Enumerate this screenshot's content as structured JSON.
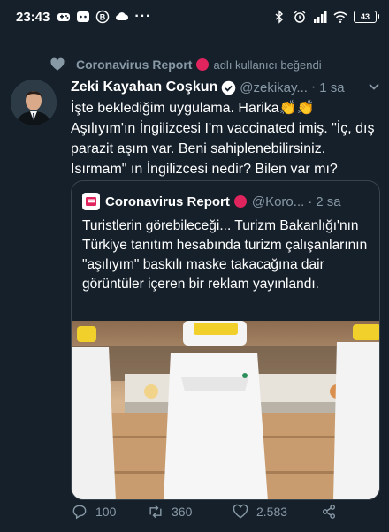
{
  "status_bar": {
    "time": "23:43",
    "battery": "43"
  },
  "social_context": {
    "account": "Coronavirus Report",
    "action": "adlı kullanıcı beğendi"
  },
  "tweet": {
    "author_name": "Zeki Kayahan Coşkun",
    "handle": "@zekikay...",
    "separator": "·",
    "time": "1 sa",
    "text": "İşte beklediğim uygulama. Harika👏👏 Aşılıyım'ın İngilizcesi I'm vaccinated imiş. \"İç, dış parazit aşım var. Beni sahiplenebilirsiniz. Isırmam\" ın İngilizcesi nedir? Bilen var mı?"
  },
  "quote": {
    "author_name": "Coronavirus Report",
    "handle": "@Koro...",
    "separator": "·",
    "time": "2 sa",
    "text": "Turistlerin görebileceği... Turizm Bakanlığı'nın Türkiye tanıtım hesabında turizm çalışanlarının \"aşılıyım\" baskılı maske takacağına dair görüntüler içeren bir reklam yayınlandı."
  },
  "actions": {
    "replies": "100",
    "retweets": "360",
    "likes": "2.583"
  },
  "colors": {
    "background": "#15202b",
    "secondary_text": "#8899a6",
    "accent_red": "#e0245e",
    "border": "#38444d"
  }
}
